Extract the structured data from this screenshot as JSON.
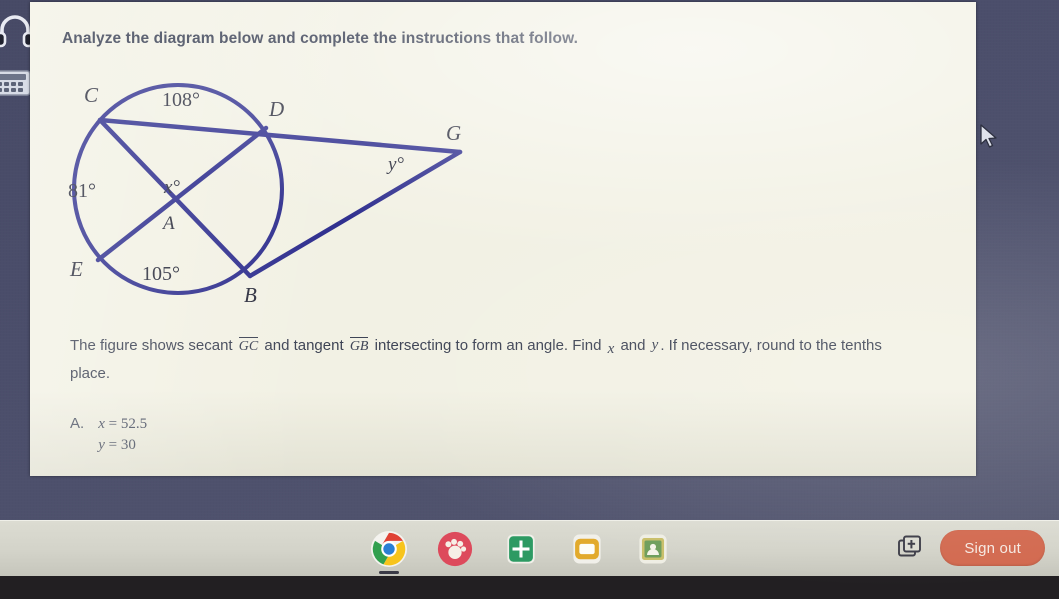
{
  "prompt": {
    "title": "Analyze the diagram below and complete the instructions that follow."
  },
  "statement": {
    "part1": "The figure shows secant",
    "secant": "GC",
    "part2": "and tangent",
    "tangent": "GB",
    "part3": "intersecting to form an angle. Find",
    "var_x": "x",
    "part4": "and",
    "var_y": "y",
    "part5": ". If necessary, round to the tenths",
    "part6": "place."
  },
  "choices": [
    {
      "letter": "A.",
      "line1_var": "x",
      "line1_eq": "=",
      "line1_val": "52.5",
      "line2_var": "y",
      "line2_eq": "=",
      "line2_val": "30"
    }
  ],
  "diagram": {
    "points": {
      "C": "C",
      "D": "D",
      "E": "E",
      "B": "B",
      "A": "A",
      "G": "G"
    },
    "arcs": {
      "top": "108°",
      "left": "81°",
      "bottom": "105°"
    },
    "angles": {
      "interior": "x°",
      "exterior": "y°"
    },
    "ink_color": "#2e2e8e"
  },
  "taskbar": {
    "icons": [
      {
        "name": "chrome-icon",
        "label": "Chrome"
      },
      {
        "name": "paw-app-icon",
        "label": "Reading App"
      },
      {
        "name": "sheets-icon",
        "label": "Sheets"
      },
      {
        "name": "notes-icon",
        "label": "Notes"
      },
      {
        "name": "classroom-icon",
        "label": "Classroom"
      }
    ],
    "new_window_label": "New window",
    "signout_label": "Sign out",
    "accent_color": "#d2694f"
  },
  "edge_icons": [
    {
      "name": "headphones-icon",
      "label": "Headphones"
    },
    {
      "name": "calculator-icon",
      "label": "Calculator"
    }
  ]
}
